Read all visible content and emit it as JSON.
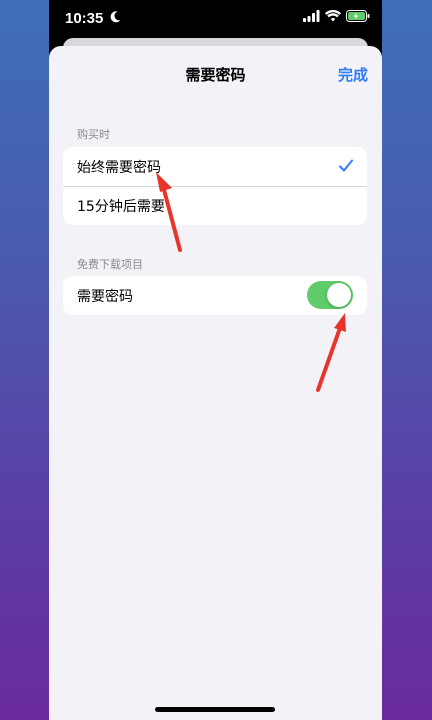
{
  "status": {
    "time": "10:35",
    "icons": [
      "moon-icon",
      "signal-icon",
      "wifi-icon",
      "battery-charging-icon"
    ]
  },
  "nav": {
    "title": "需要密码",
    "done_label": "完成"
  },
  "purchase_section": {
    "header": "购买时",
    "options": [
      {
        "label": "始终需要密码",
        "selected": true
      },
      {
        "label": "15分钟后需要",
        "selected": false
      }
    ]
  },
  "free_section": {
    "header": "免费下载项目",
    "toggle_label": "需要密码",
    "toggle_on": true
  },
  "colors": {
    "accent": "#2f7cf6",
    "toggle_on": "#5fcb6a",
    "annotation_arrow": "#e8352b"
  }
}
